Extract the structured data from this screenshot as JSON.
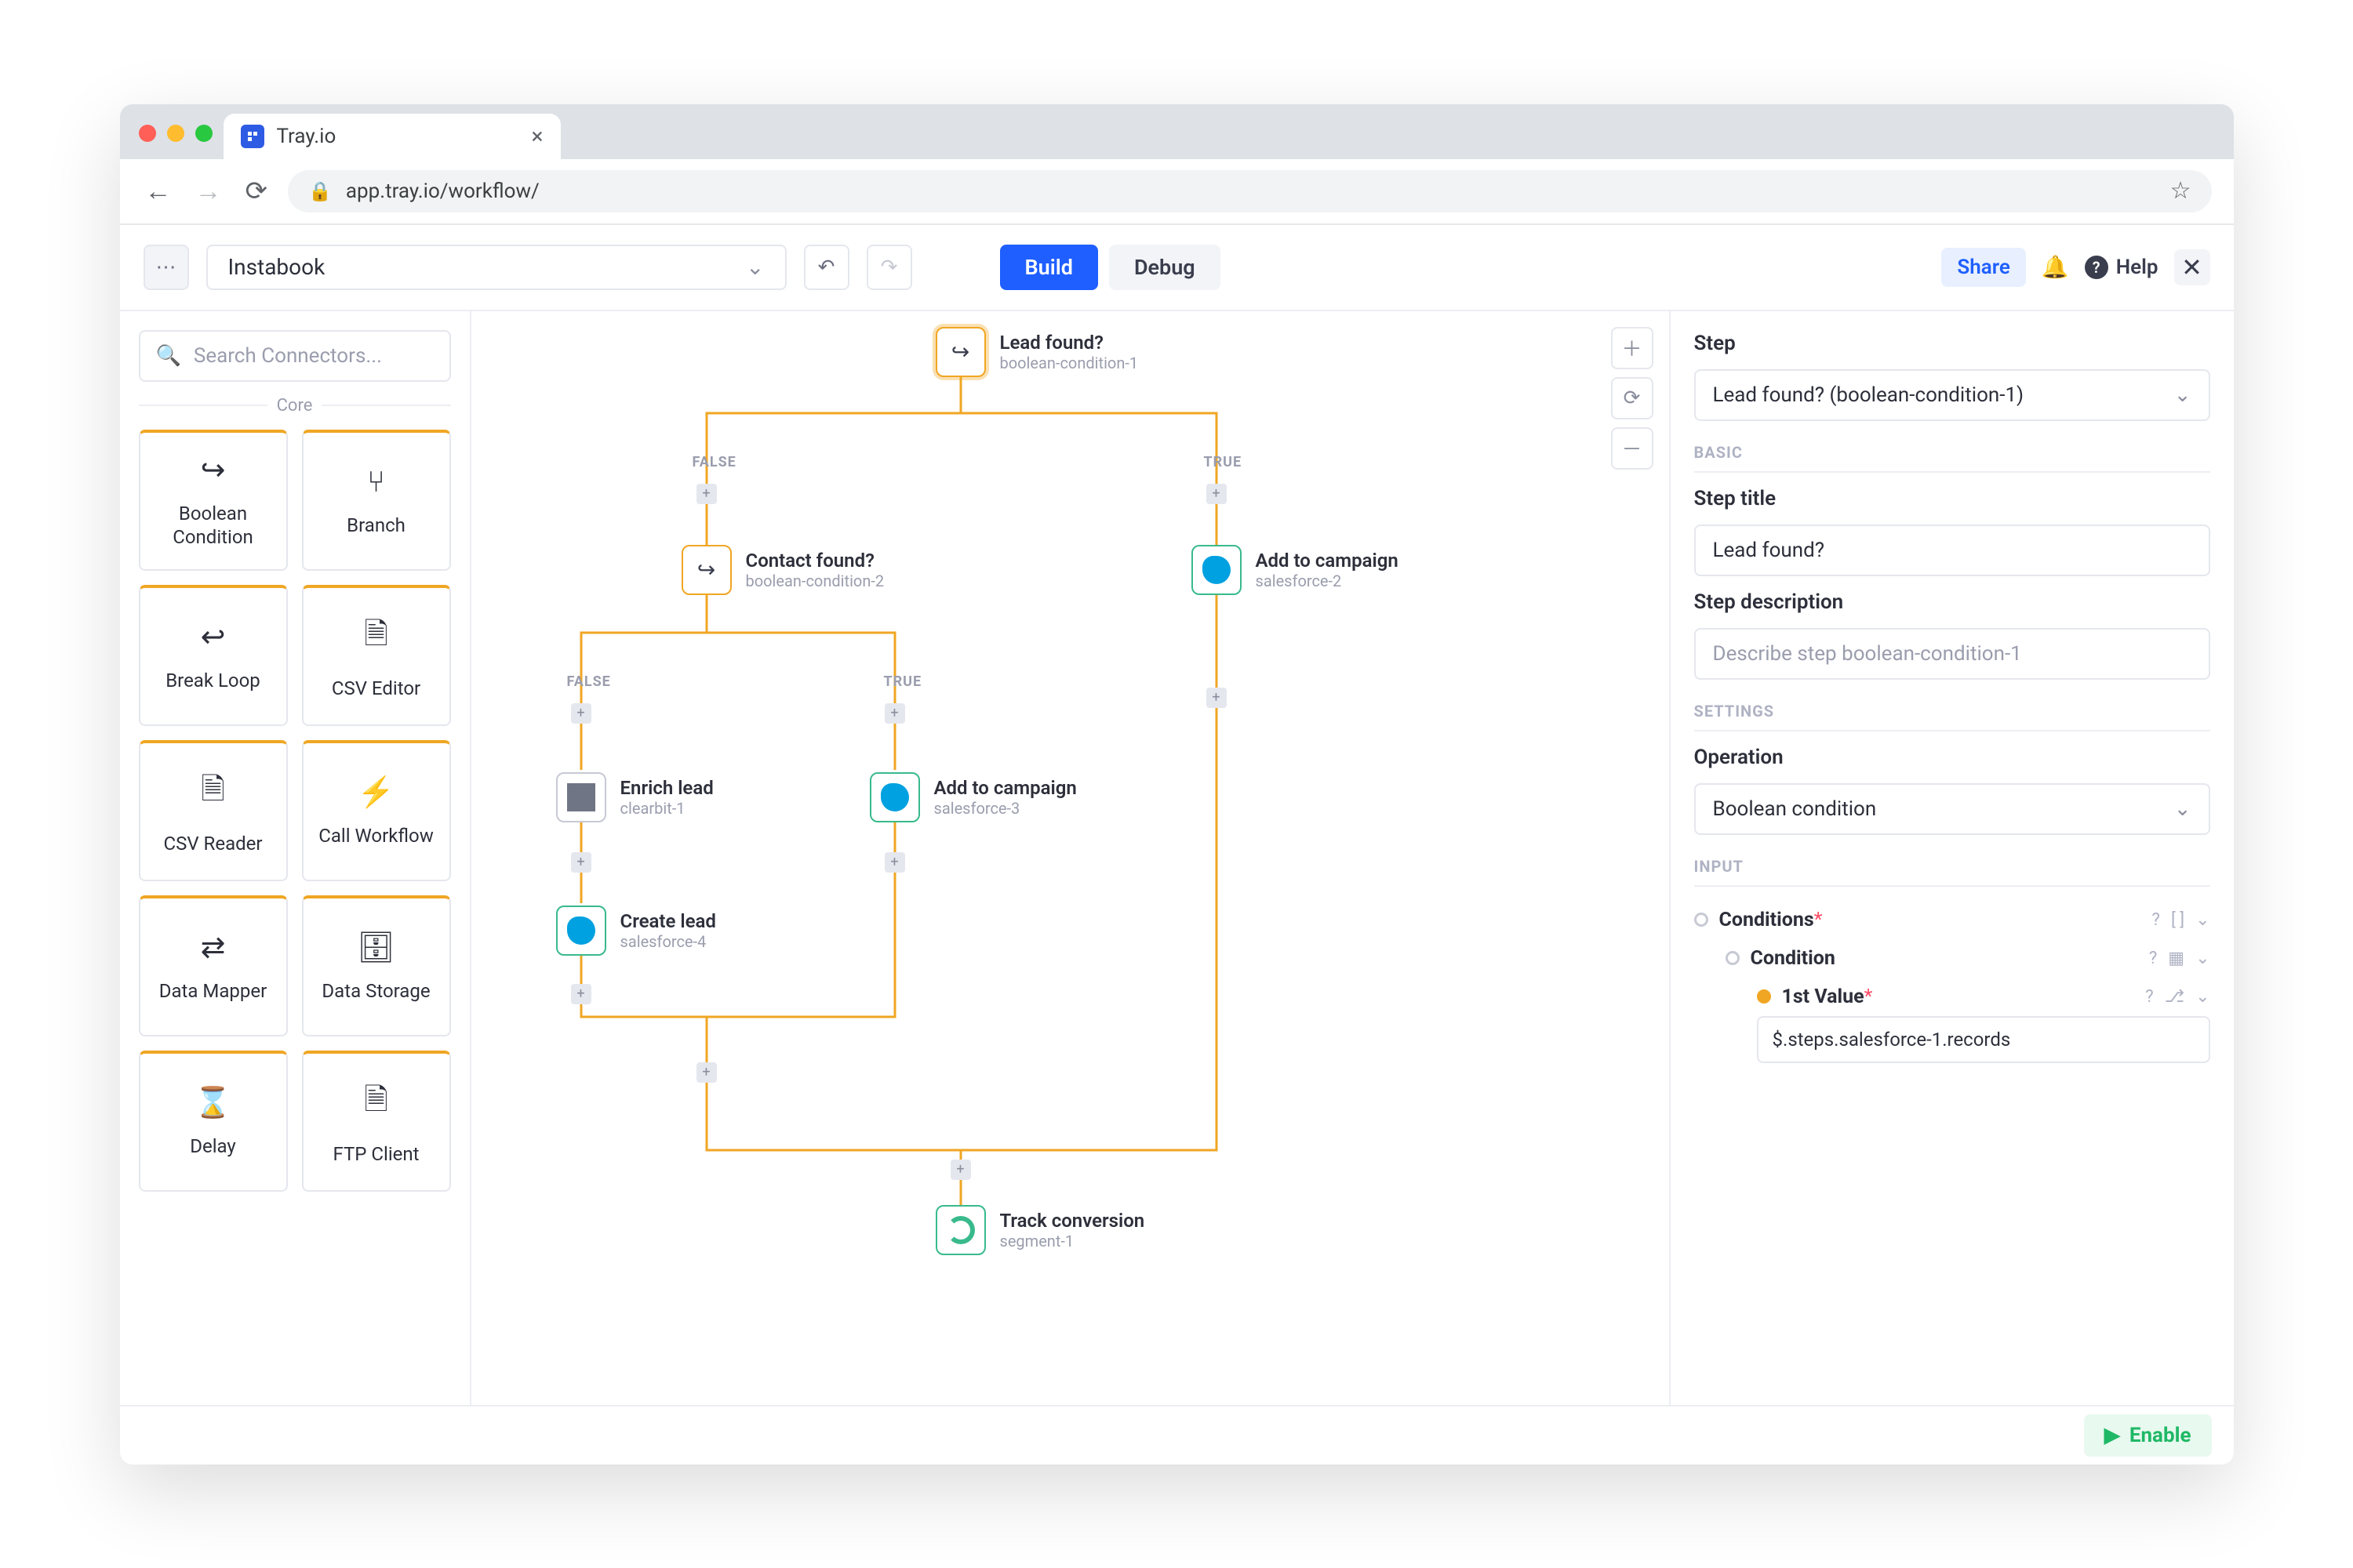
{
  "browser": {
    "tab_title": "Tray.io",
    "url": "app.tray.io/workflow/"
  },
  "toolbar": {
    "workflow_name": "Instabook",
    "build_label": "Build",
    "debug_label": "Debug",
    "share_label": "Share",
    "help_label": "Help"
  },
  "palette": {
    "search_placeholder": "Search Connectors...",
    "core_label": "Core",
    "items": [
      {
        "label": "Boolean Condition",
        "icon": "↪"
      },
      {
        "label": "Branch",
        "icon": "⑂"
      },
      {
        "label": "Break Loop",
        "icon": "↩"
      },
      {
        "label": "CSV Editor",
        "icon": "🗎"
      },
      {
        "label": "CSV Reader",
        "icon": "🗎"
      },
      {
        "label": "Call Workflow",
        "icon": "⚡"
      },
      {
        "label": "Data Mapper",
        "icon": "⇄"
      },
      {
        "label": "Data Storage",
        "icon": "🗄"
      },
      {
        "label": "Delay",
        "icon": "⌛"
      },
      {
        "label": "FTP Client",
        "icon": "🗎"
      }
    ]
  },
  "canvas": {
    "false_label": "FALSE",
    "true_label": "TRUE",
    "nodes": {
      "n1": {
        "title": "Lead found?",
        "sub": "boolean-condition-1"
      },
      "n2": {
        "title": "Contact found?",
        "sub": "boolean-condition-2"
      },
      "n3": {
        "title": "Add to campaign",
        "sub": "salesforce-2"
      },
      "n4": {
        "title": "Enrich lead",
        "sub": "clearbit-1"
      },
      "n5": {
        "title": "Add to campaign",
        "sub": "salesforce-3"
      },
      "n6": {
        "title": "Create lead",
        "sub": "salesforce-4"
      },
      "n7": {
        "title": "Track conversion",
        "sub": "segment-1"
      }
    }
  },
  "right": {
    "step_heading": "Step",
    "step_selector": "Lead found? (boolean-condition-1)",
    "basic_label": "BASIC",
    "step_title_label": "Step title",
    "step_title_value": "Lead found?",
    "step_desc_label": "Step description",
    "step_desc_placeholder": "Describe step boolean-condition-1",
    "settings_label": "SETTINGS",
    "operation_label": "Operation",
    "operation_value": "Boolean condition",
    "input_label": "INPUT",
    "conditions_label": "Conditions",
    "condition_label": "Condition",
    "first_value_label": "1st Value",
    "first_value_path": "$.steps.salesforce-1.records"
  },
  "footer": {
    "enable_label": "Enable"
  }
}
